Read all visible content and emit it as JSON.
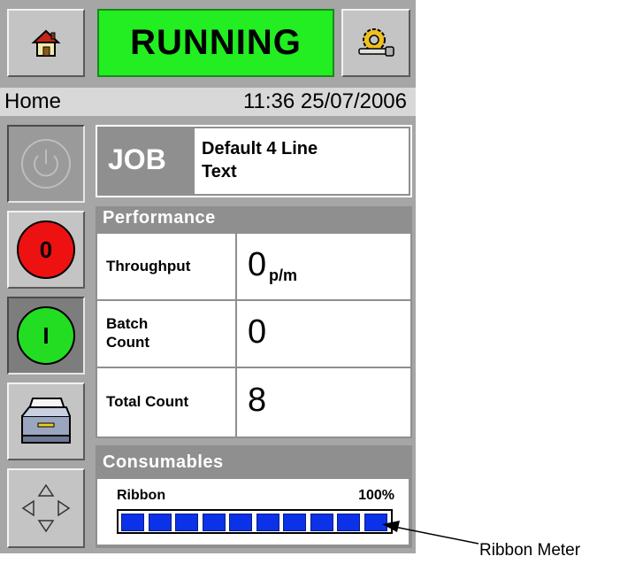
{
  "header": {
    "status": "RUNNING",
    "home_icon": "home-icon",
    "setup_icon": "setup-key-icon"
  },
  "info_bar": {
    "page": "Home",
    "datetime": "11:36 25/07/2006"
  },
  "sidebar": {
    "power_icon": "power-icon",
    "stop_label": "0",
    "start_label": "I",
    "printer_icon": "printer-icon",
    "nav_icon": "arrow-pad-icon"
  },
  "job": {
    "label": "JOB",
    "name_line1": "Default 4 Line",
    "name_line2": "Text"
  },
  "performance": {
    "title": "Performance",
    "throughput_label": "Throughput",
    "throughput_value": "0",
    "throughput_unit": "p/m",
    "batch_label_1": "Batch",
    "batch_label_2": "Count",
    "batch_value": "0",
    "total_label": "Total Count",
    "total_value": "8"
  },
  "consumables": {
    "title": "Consumables",
    "ribbon_label": "Ribbon",
    "ribbon_percent_text": "100%",
    "ribbon_level": 1.0
  },
  "annotation": {
    "ribbon_meter": "Ribbon Meter"
  },
  "colors": {
    "running": "#22ee22",
    "stop": "#ee1111",
    "start": "#22dd22",
    "meter": "#0b32e8"
  }
}
